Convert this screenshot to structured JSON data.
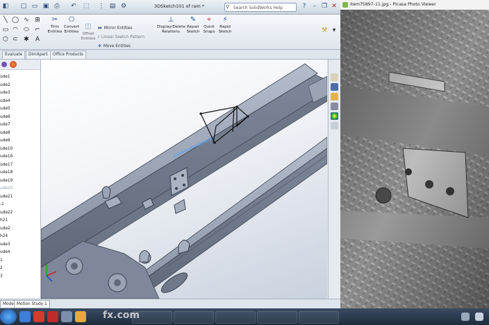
{
  "solidworks": {
    "document_title": "3DSketch101 of ram *",
    "search_placeholder": "Search SolidWorks Help",
    "ribbon": {
      "trim": "Trim Entities",
      "convert": "Convert Entities",
      "offset": "Offset Entities",
      "mirror": "Mirror Entities",
      "linear_pattern": "Linear Sketch Pattern",
      "move": "Move Entities",
      "display_delete": "Display/Delete Relations",
      "repair": "Repair Sketch",
      "quick_snaps": "Quick Snaps",
      "rapid": "Rapid Sketch"
    },
    "tabs": [
      "Evaluate",
      "DimXpert",
      "Office Products"
    ],
    "tree": [
      {
        "label": "ude1",
        "dim": false
      },
      {
        "label": "ude2",
        "dim": false
      },
      {
        "label": "ude3",
        "dim": false
      },
      {
        "label": "ude4",
        "dim": false
      },
      {
        "label": "ude5",
        "dim": false
      },
      {
        "label": "ude6",
        "dim": false
      },
      {
        "label": "ude7",
        "dim": false
      },
      {
        "label": "ude8",
        "dim": false
      },
      {
        "label": "ude9",
        "dim": false
      },
      {
        "label": "ude10",
        "dim": false
      },
      {
        "label": "ude16",
        "dim": false
      },
      {
        "label": "ude17",
        "dim": false
      },
      {
        "label": "ude18",
        "dim": false
      },
      {
        "label": "ude19",
        "dim": false
      },
      {
        "label": "ude20",
        "dim": true
      },
      {
        "label": "ude21",
        "dim": false
      },
      {
        "label": "-1",
        "dim": false
      },
      {
        "label": "ude22",
        "dim": false
      },
      {
        "label": "h21",
        "dim": false
      },
      {
        "label": "ude2",
        "dim": false
      },
      {
        "label": "h24",
        "dim": false
      },
      {
        "label": "ude3",
        "dim": false
      },
      {
        "label": "ude4",
        "dim": false
      },
      {
        "label": "1",
        "dim": false
      },
      {
        "label": "2",
        "dim": false
      },
      {
        "label": "3",
        "dim": false
      }
    ],
    "bottom_tabs": [
      "Model",
      "Motion Study 1"
    ]
  },
  "picasa": {
    "title": "item75897-11.jpg - Picasa Photo Viewer"
  },
  "watermark": {
    "text": "fx.com"
  },
  "colors": {
    "ribbon_icon": "#1f4e9a",
    "viewport_model": "#8e98a8",
    "taskbar": "#1e2b3c"
  }
}
